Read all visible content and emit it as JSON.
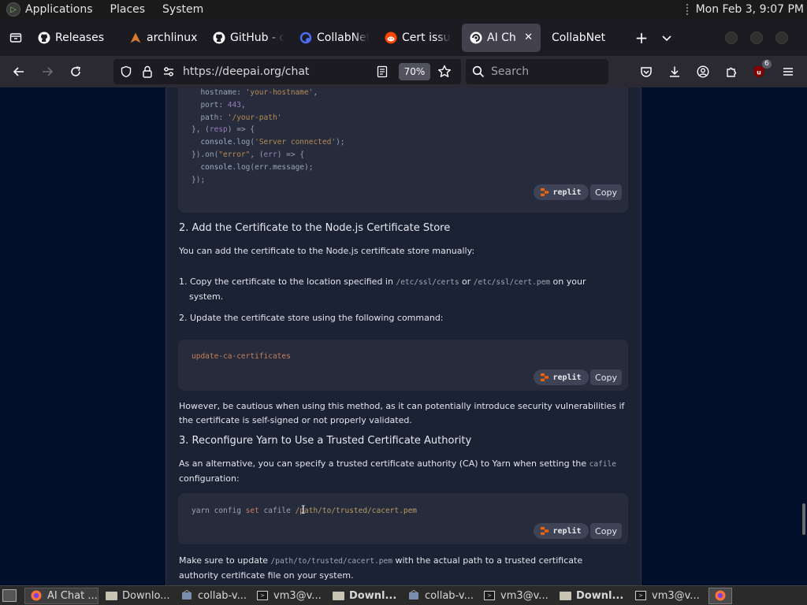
{
  "topbar": {
    "menus": [
      "Applications",
      "Places",
      "System"
    ],
    "clock": "Mon Feb  3,  9:07 PM"
  },
  "tabs": [
    {
      "label": "Releases",
      "icon": "github-icon"
    },
    {
      "label": "archlinux",
      "icon": "archlinux-icon"
    },
    {
      "label": "GitHub - c",
      "icon": "github-icon"
    },
    {
      "label": "CollabNet",
      "icon": "collabnet-icon"
    },
    {
      "label": "Cert issue",
      "icon": "reddit-icon"
    },
    {
      "label": "AI Chat",
      "icon": "deepai-icon",
      "active": true
    },
    {
      "label": "CollabNet",
      "icon": ""
    }
  ],
  "navbar": {
    "url": "https://deepai.org/chat",
    "zoom": "70%",
    "search_placeholder": "Search",
    "ublock_badge": "6"
  },
  "content": {
    "code1_lines": [
      "  hostname: 'your-hostname',",
      "  port: 443,",
      "  path: '/your-path'",
      "}, (resp) => {",
      "  console.log('Server connected');",
      "}).on(\"error\", (err) => {",
      "  console.log(err.message);",
      "});"
    ],
    "replit_label": "replit",
    "copy_label": "Copy",
    "heading2": "2. Add the Certificate to the Node.js Certificate Store",
    "para_store": "You can add the certificate to the Node.js certificate store manually:",
    "step1_a": "1. Copy the certificate to the location specified in ",
    "step1_code1": "/etc/ssl/certs",
    "step1_b": " or ",
    "step1_code2": "/etc/ssl/cert.pem",
    "step1_c": " on your",
    "step1_d": "system.",
    "step2": "2. Update the certificate store using the following command:",
    "code2": "update-ca-certificates",
    "caution": "However, be cautious when using this method, as it can potentially introduce security vulnerabilities if the certificate is self-signed or not properly validated.",
    "heading3": "3. Reconfigure Yarn to Use a Trusted Certificate Authority",
    "alt_a": "As an alternative, you can specify a trusted certificate authority (CA) to Yarn when setting the ",
    "alt_code": "cafile",
    "alt_b": "configuration:",
    "code3_a": "yarn config ",
    "code3_set": "set",
    "code3_b": " cafile ",
    "code3_path": "/path/to/trusted/cacert.pem",
    "make_a": "Make sure to update ",
    "make_code": "/path/to/trusted/cacert.pem",
    "make_b": " with the actual path to a trusted certificate",
    "make_c": "authority certificate file on your system."
  },
  "taskbar": [
    {
      "label": "AI Chat ...",
      "icon": "firefox-icon",
      "active": true,
      "bold": false
    },
    {
      "label": "Downlo...",
      "icon": "folder-icon",
      "active": false,
      "bold": false
    },
    {
      "label": "collab-v...",
      "icon": "app-icon",
      "active": false,
      "bold": false
    },
    {
      "label": "vm3@v...",
      "icon": "terminal-icon",
      "active": false,
      "bold": false
    },
    {
      "label": "Downl...",
      "icon": "folder-icon",
      "active": false,
      "bold": true
    },
    {
      "label": "collab-v...",
      "icon": "app-icon",
      "active": false,
      "bold": false
    },
    {
      "label": "vm3@v...",
      "icon": "terminal-icon",
      "active": false,
      "bold": false
    },
    {
      "label": "Downl...",
      "icon": "folder-icon",
      "active": false,
      "bold": true
    },
    {
      "label": "vm3@v...",
      "icon": "terminal-icon",
      "active": false,
      "bold": false
    }
  ],
  "colors": {
    "page_bg": "#020f2a",
    "pane_bg": "#1b2233",
    "code_bg": "#262c3c",
    "tab_active": "#42414d"
  }
}
